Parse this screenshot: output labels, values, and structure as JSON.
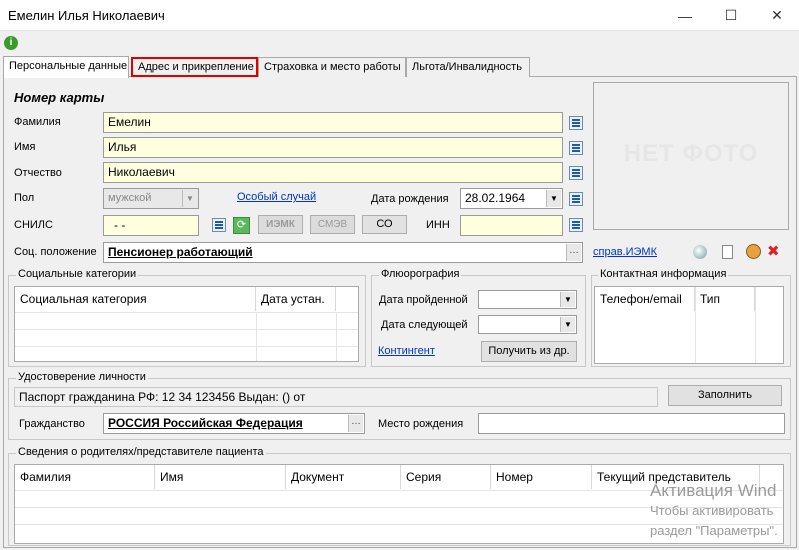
{
  "window": {
    "title": "Емелин Илья Николаевич",
    "minimize": "—",
    "maximize": "☐",
    "close": "✕"
  },
  "tabs": [
    {
      "label": "Персональные данные",
      "active": true
    },
    {
      "label": "Адрес и прикрепление",
      "highlighted": true
    },
    {
      "label": "Страховка и место работы"
    },
    {
      "label": "Льгота/Инвалидность"
    }
  ],
  "personal": {
    "card_label": "Номер карты",
    "surname_label": "Фамилия",
    "surname": "Емелин",
    "name_label": "Имя",
    "name": "Илья",
    "patronymic_label": "Отчество",
    "patronymic": "Николаевич",
    "sex_label": "Пол",
    "sex": "мужской",
    "special_case_link": "Особый случай",
    "birth_label": "Дата рождения",
    "birth_date": "28.02.1964",
    "snils_label": "СНИЛС",
    "snils": "-  -",
    "iemk_button": "ИЭМК",
    "smev_button": "СМЭВ",
    "co_button": "СО",
    "inn_label": "ИНН",
    "inn": "",
    "social_label": "Соц. положение",
    "social_value": "Пенсионер работающий",
    "iemk_link": "справ.ИЭМК"
  },
  "photo": {
    "no_photo_text": "НЕТ ФОТО"
  },
  "social_categories": {
    "title": "Социальные категории",
    "columns": [
      "Социальная категория",
      "Дата устан."
    ]
  },
  "fluoro": {
    "title": "Флюорография",
    "date_done_label": "Дата пройденной",
    "date_next_label": "Дата следующей",
    "contingent_link": "Контингент",
    "get_button": "Получить из др."
  },
  "contacts": {
    "title": "Контактная информация",
    "columns": [
      "Телефон/email",
      "Тип"
    ]
  },
  "identity": {
    "title": "Удостоверение личности",
    "document": "Паспорт гражданина РФ: 12 34 123456 Выдан: () от",
    "fill_button": "Заполнить",
    "citizenship_label": "Гражданство",
    "citizenship": "РОССИЯ Российская Федерация",
    "birthplace_label": "Место рождения",
    "birthplace": ""
  },
  "parents": {
    "title": "Сведения о родителях/представителе пациента",
    "columns": [
      "Фамилия",
      "Имя",
      "Документ",
      "Серия",
      "Номер",
      "Текущий представитель"
    ]
  },
  "activation": {
    "line1": "Активация Wind",
    "line2": "Чтобы активировать",
    "line3": "раздел \"Параметры\"."
  }
}
